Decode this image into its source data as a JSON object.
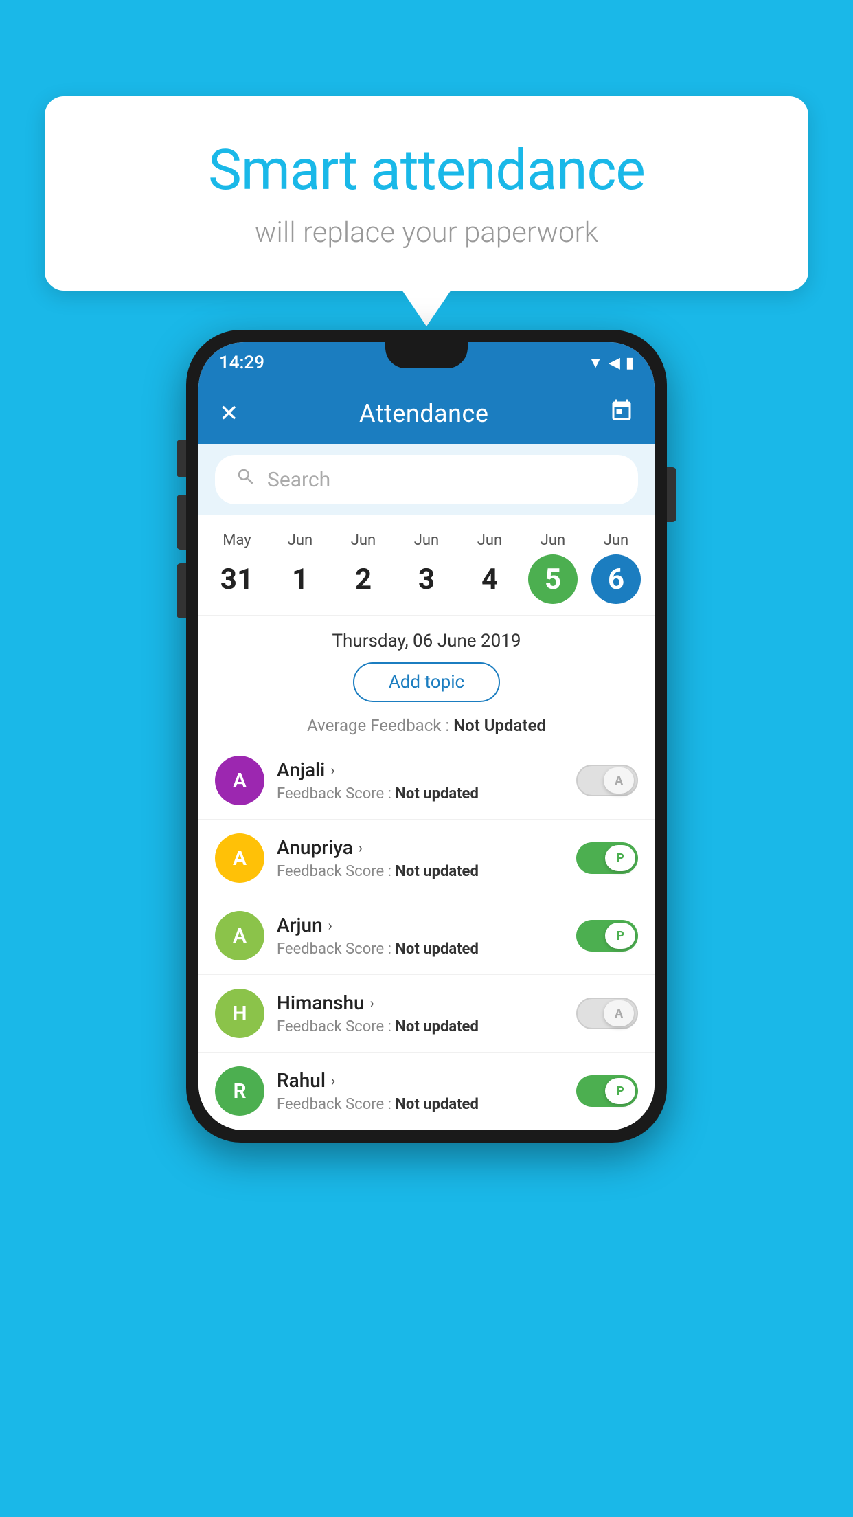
{
  "background_color": "#1AB8E8",
  "bubble": {
    "title": "Smart attendance",
    "subtitle": "will replace your paperwork"
  },
  "phone": {
    "status_bar": {
      "time": "14:29",
      "icons": "▼◀▮"
    },
    "app_bar": {
      "title": "Attendance",
      "close_icon": "✕",
      "calendar_icon": "📅"
    },
    "search": {
      "placeholder": "Search"
    },
    "calendar": {
      "days": [
        {
          "month": "May",
          "date": "31",
          "state": "normal"
        },
        {
          "month": "Jun",
          "date": "1",
          "state": "normal"
        },
        {
          "month": "Jun",
          "date": "2",
          "state": "normal"
        },
        {
          "month": "Jun",
          "date": "3",
          "state": "normal"
        },
        {
          "month": "Jun",
          "date": "4",
          "state": "normal"
        },
        {
          "month": "Jun",
          "date": "5",
          "state": "today"
        },
        {
          "month": "Jun",
          "date": "6",
          "state": "selected"
        }
      ]
    },
    "selected_date": {
      "label": "Thursday, 06 June 2019",
      "add_topic_btn": "Add topic",
      "avg_feedback_label": "Average Feedback :",
      "avg_feedback_value": "Not Updated"
    },
    "students": [
      {
        "name": "Anjali",
        "avatar_letter": "A",
        "avatar_color": "#9C27B0",
        "feedback": "Feedback Score :",
        "feedback_value": "Not updated",
        "toggle": "off",
        "toggle_letter": "A"
      },
      {
        "name": "Anupriya",
        "avatar_letter": "A",
        "avatar_color": "#FFC107",
        "feedback": "Feedback Score :",
        "feedback_value": "Not updated",
        "toggle": "on",
        "toggle_letter": "P"
      },
      {
        "name": "Arjun",
        "avatar_letter": "A",
        "avatar_color": "#8BC34A",
        "feedback": "Feedback Score :",
        "feedback_value": "Not updated",
        "toggle": "on",
        "toggle_letter": "P"
      },
      {
        "name": "Himanshu",
        "avatar_letter": "H",
        "avatar_color": "#8BC34A",
        "feedback": "Feedback Score :",
        "feedback_value": "Not updated",
        "toggle": "off",
        "toggle_letter": "A"
      },
      {
        "name": "Rahul",
        "avatar_letter": "R",
        "avatar_color": "#4CAF50",
        "feedback": "Feedback Score :",
        "feedback_value": "Not updated",
        "toggle": "on",
        "toggle_letter": "P"
      }
    ]
  }
}
